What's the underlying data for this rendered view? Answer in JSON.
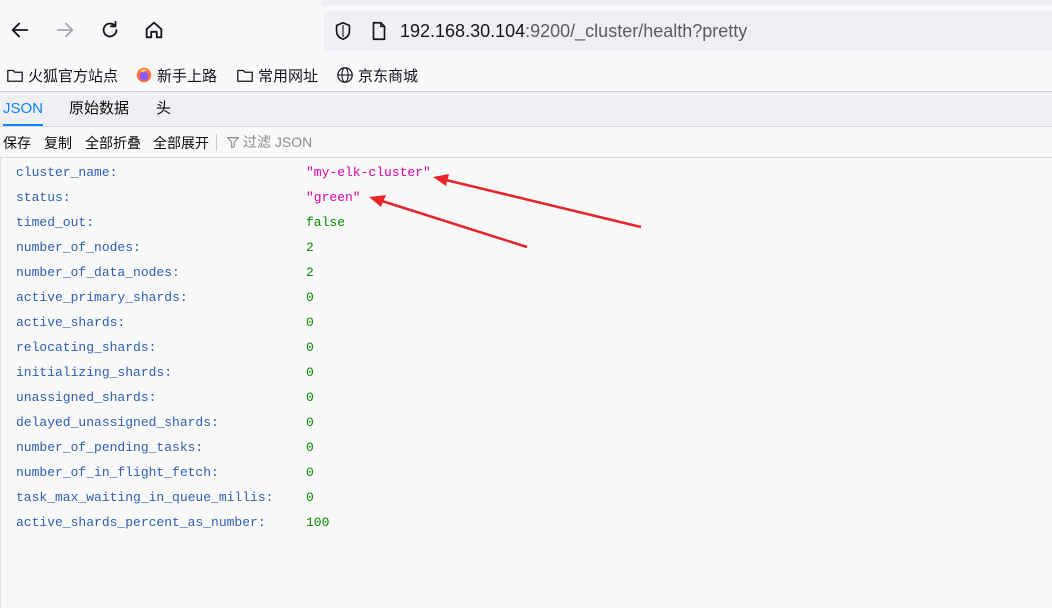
{
  "browser": {
    "url_host": "192.168.30.104",
    "url_path": ":9200/_cluster/health?pretty"
  },
  "bookmarks": [
    {
      "label": "火狐官方站点",
      "icon": "folder-icon"
    },
    {
      "label": "新手上路",
      "icon": "firefox-icon"
    },
    {
      "label": "常用网址",
      "icon": "folder-icon"
    },
    {
      "label": "京东商城",
      "icon": "globe-icon"
    }
  ],
  "viewer": {
    "tabs": [
      {
        "label": "JSON",
        "active": true
      },
      {
        "label": "原始数据",
        "active": false
      },
      {
        "label": "头",
        "active": false
      }
    ],
    "toolbar": {
      "save": "保存",
      "copy": "复制",
      "collapse_all": "全部折叠",
      "expand_all": "全部展开",
      "filter_placeholder": "过滤 JSON"
    }
  },
  "json": [
    {
      "key": "cluster_name:",
      "value": "\"my-elk-cluster\"",
      "type": "str"
    },
    {
      "key": "status:",
      "value": "\"green\"",
      "type": "str"
    },
    {
      "key": "timed_out:",
      "value": "false",
      "type": "bool"
    },
    {
      "key": "number_of_nodes:",
      "value": "2",
      "type": "num"
    },
    {
      "key": "number_of_data_nodes:",
      "value": "2",
      "type": "num"
    },
    {
      "key": "active_primary_shards:",
      "value": "0",
      "type": "num"
    },
    {
      "key": "active_shards:",
      "value": "0",
      "type": "num"
    },
    {
      "key": "relocating_shards:",
      "value": "0",
      "type": "num"
    },
    {
      "key": "initializing_shards:",
      "value": "0",
      "type": "num"
    },
    {
      "key": "unassigned_shards:",
      "value": "0",
      "type": "num"
    },
    {
      "key": "delayed_unassigned_shards:",
      "value": "0",
      "type": "num"
    },
    {
      "key": "number_of_pending_tasks:",
      "value": "0",
      "type": "num"
    },
    {
      "key": "number_of_in_flight_fetch:",
      "value": "0",
      "type": "num"
    },
    {
      "key": "task_max_waiting_in_queue_millis:",
      "value": "0",
      "type": "num"
    },
    {
      "key": "active_shards_percent_as_number:",
      "value": "100",
      "type": "num"
    }
  ],
  "colors": {
    "key": "#2d5eb3",
    "string": "#dd00a9",
    "number": "#058b00",
    "accent": "#0a84ff",
    "annotation_arrow": "#e8242b"
  }
}
